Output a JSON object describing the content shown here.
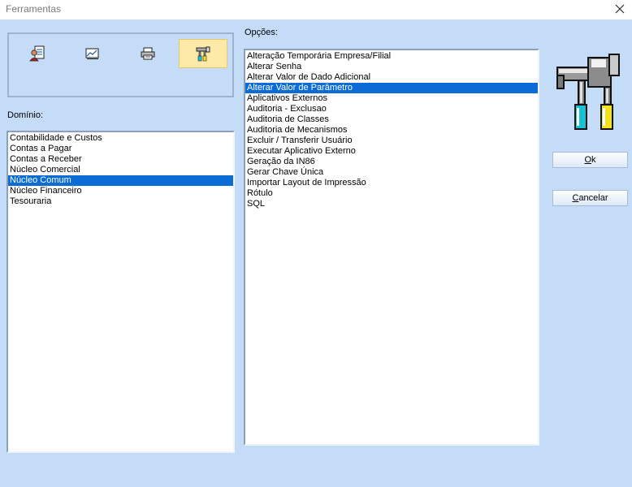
{
  "window": {
    "title": "Ferramentas"
  },
  "toolbar": {
    "buttons": [
      {
        "name": "user-document",
        "icon": "user-document-icon",
        "active": false
      },
      {
        "name": "chart-report",
        "icon": "chart-icon",
        "active": false
      },
      {
        "name": "print",
        "icon": "printer-icon",
        "active": false
      },
      {
        "name": "tools",
        "icon": "tools-icon",
        "active": true
      }
    ]
  },
  "dominio": {
    "label": "Domínio:",
    "items": [
      "Contabilidade e Custos",
      "Contas a Pagar",
      "Contas a Receber",
      "Núcleo Comercial",
      "Núcleo Comum",
      "Núcleo Financeiro",
      "Tesouraria"
    ],
    "selected": "Núcleo Comum"
  },
  "opcoes": {
    "label": "Opções:",
    "items": [
      "Alteração Temporária Empresa/Filial",
      "Alterar Senha",
      "Alterar Valor de Dado Adicional",
      "Alterar Valor de Parâmetro",
      "Aplicativos Externos",
      "Auditoria - Exclusao",
      "Auditoria de Classes",
      "Auditoria de Mecanismos",
      "Excluir / Transferir Usuário",
      "Executar Aplicativo Externo",
      "Geração da IN86",
      "Gerar Chave Única",
      "Importar Layout de Impressão",
      "Rótulo",
      "SQL"
    ],
    "selected": "Alterar Valor de Parâmetro"
  },
  "actions": {
    "ok_mnemonic": "O",
    "ok_rest": "k",
    "cancel_mnemonic": "C",
    "cancel_rest": "ancelar"
  },
  "colors": {
    "background": "#c5dcf9",
    "selection": "#0c6cd6",
    "active_tool": "#fde9a8"
  }
}
